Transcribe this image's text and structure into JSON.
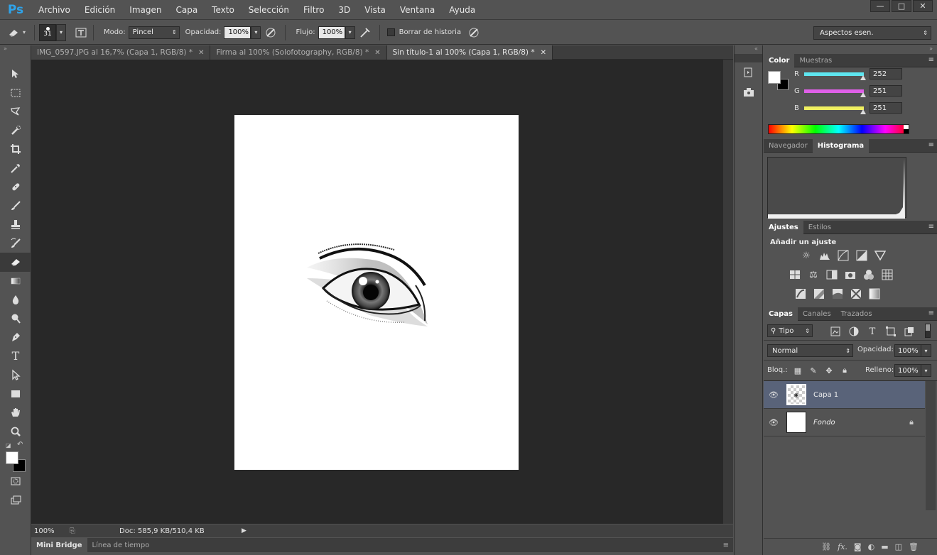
{
  "app": {
    "logo": "Ps"
  },
  "menu": [
    "Archivo",
    "Edición",
    "Imagen",
    "Capa",
    "Texto",
    "Selección",
    "Filtro",
    "3D",
    "Vista",
    "Ventana",
    "Ayuda"
  ],
  "window_controls": [
    "—",
    "□",
    "✕"
  ],
  "options": {
    "brush_size": "31",
    "mode_label": "Modo:",
    "mode_value": "Pincel",
    "opacity_label": "Opacidad:",
    "opacity_value": "100%",
    "flow_label": "Flujo:",
    "flow_value": "100%",
    "erase_history_label": "Borrar de historia",
    "workspace": "Aspectos esen."
  },
  "doc_tabs": [
    {
      "label": "IMG_0597.JPG al 16,7% (Capa 1, RGB/8) *",
      "active": false
    },
    {
      "label": "Firma al 100% (Solofotography, RGB/8) *",
      "active": false
    },
    {
      "label": "Sin título-1 al 100% (Capa 1, RGB/8) *",
      "active": true
    }
  ],
  "status": {
    "zoom": "100%",
    "doc": "Doc: 585,9 KB/510,4 KB"
  },
  "bottom_tabs": [
    "Mini Bridge",
    "Línea de tiempo"
  ],
  "color_panel": {
    "tabs": [
      "Color",
      "Muestras"
    ],
    "channels": [
      {
        "name": "R",
        "value": "252",
        "level": 0.988,
        "color": "#5ee6f0"
      },
      {
        "name": "G",
        "value": "251",
        "level": 0.984,
        "color": "#e060e8"
      },
      {
        "name": "B",
        "value": "251",
        "level": 0.984,
        "color": "#f0f060"
      }
    ]
  },
  "histogram_panel": {
    "tabs": [
      "Navegador",
      "Histograma"
    ]
  },
  "adjust_panel": {
    "tabs": [
      "Ajustes",
      "Estilos"
    ],
    "title": "Añadir un ajuste"
  },
  "layers_panel": {
    "tabs": [
      "Capas",
      "Canales",
      "Trazados"
    ],
    "filter": "Tipo",
    "blend": "Normal",
    "opacity_label": "Opacidad:",
    "opacity": "100%",
    "lock_label": "Bloq.:",
    "fill_label": "Relleno:",
    "fill": "100%",
    "layers": [
      {
        "name": "Capa 1",
        "selected": true
      },
      {
        "name": "Fondo",
        "selected": false
      }
    ]
  }
}
